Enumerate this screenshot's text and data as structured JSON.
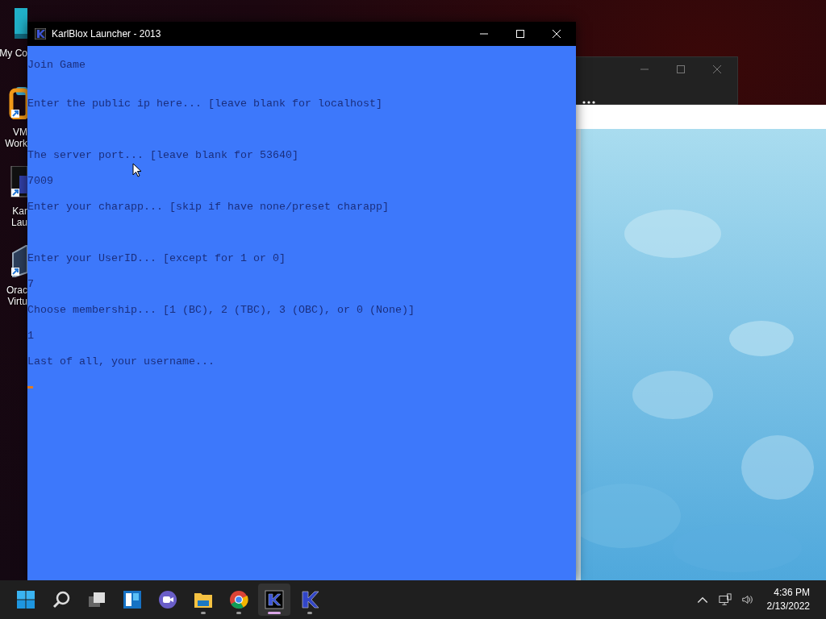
{
  "desktop_icons": [
    {
      "kind": "computer",
      "label_lines": [
        "My Co"
      ]
    },
    {
      "kind": "vm",
      "label_lines": [
        "VM",
        "Work"
      ]
    },
    {
      "kind": "launcher",
      "label_lines": [
        "Kar",
        "Lau"
      ]
    },
    {
      "kind": "virtualbox",
      "label_lines": [
        "Orac",
        "Virtu"
      ]
    }
  ],
  "window": {
    "title": "KarlBlox Launcher - 2013"
  },
  "console": [
    {
      "kind": "title",
      "text": "Join Game"
    },
    {
      "kind": "prompt",
      "text": "Enter the public ip here... [leave blank for localhost]"
    },
    {
      "kind": "prompt",
      "text": "The server port... [leave blank for 53640]"
    },
    {
      "kind": "answer",
      "text": "7009"
    },
    {
      "kind": "prompt",
      "text": "Enter your charapp... [skip if have none/preset charapp]"
    },
    {
      "kind": "prompt",
      "text": "Enter your UserID... [except for 1 or 0]"
    },
    {
      "kind": "answer",
      "text": "7"
    },
    {
      "kind": "prompt",
      "text": "Choose membership... [1 (BC), 2 (TBC), 3 (OBC), or 0 (None)]"
    },
    {
      "kind": "answer",
      "text": "1"
    },
    {
      "kind": "prompt",
      "text": "Last of all, your username..."
    }
  ],
  "taskbar": {
    "apps": [
      {
        "kind": "start",
        "running": false,
        "active": false
      },
      {
        "kind": "search",
        "running": false,
        "active": false
      },
      {
        "kind": "taskview",
        "running": false,
        "active": false
      },
      {
        "kind": "widgets",
        "running": false,
        "active": false
      },
      {
        "kind": "chat",
        "running": false,
        "active": false
      },
      {
        "kind": "files",
        "running": true,
        "active": false
      },
      {
        "kind": "browser",
        "running": true,
        "active": false
      },
      {
        "kind": "launcher-dark",
        "running": true,
        "active": true
      },
      {
        "kind": "launcher",
        "running": true,
        "active": false
      }
    ],
    "time": "4:36 PM",
    "date": "2/13/2022"
  }
}
